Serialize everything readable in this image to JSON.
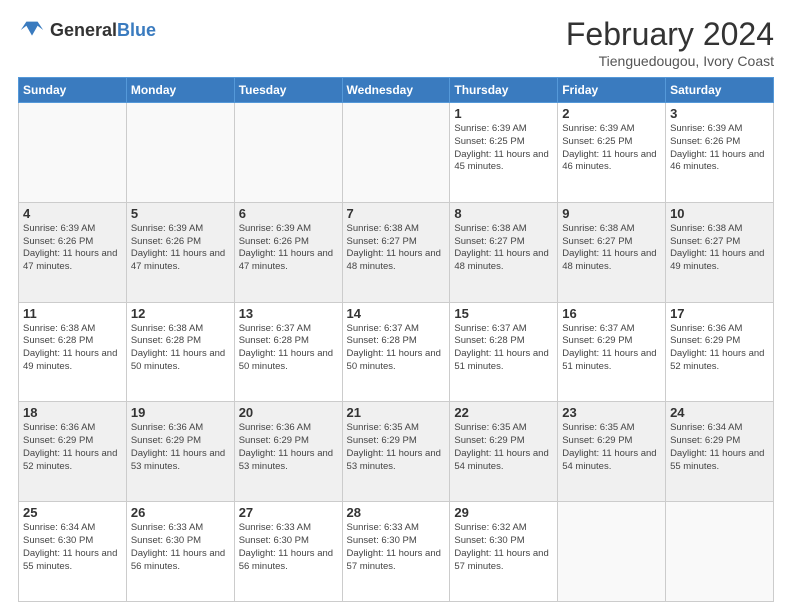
{
  "header": {
    "logo_general": "General",
    "logo_blue": "Blue",
    "month_year": "February 2024",
    "location": "Tienguedougou, Ivory Coast"
  },
  "days_of_week": [
    "Sunday",
    "Monday",
    "Tuesday",
    "Wednesday",
    "Thursday",
    "Friday",
    "Saturday"
  ],
  "weeks": [
    [
      {
        "day": "",
        "info": ""
      },
      {
        "day": "",
        "info": ""
      },
      {
        "day": "",
        "info": ""
      },
      {
        "day": "",
        "info": ""
      },
      {
        "day": "1",
        "info": "Sunrise: 6:39 AM\nSunset: 6:25 PM\nDaylight: 11 hours\nand 45 minutes."
      },
      {
        "day": "2",
        "info": "Sunrise: 6:39 AM\nSunset: 6:25 PM\nDaylight: 11 hours\nand 46 minutes."
      },
      {
        "day": "3",
        "info": "Sunrise: 6:39 AM\nSunset: 6:26 PM\nDaylight: 11 hours\nand 46 minutes."
      }
    ],
    [
      {
        "day": "4",
        "info": "Sunrise: 6:39 AM\nSunset: 6:26 PM\nDaylight: 11 hours\nand 47 minutes."
      },
      {
        "day": "5",
        "info": "Sunrise: 6:39 AM\nSunset: 6:26 PM\nDaylight: 11 hours\nand 47 minutes."
      },
      {
        "day": "6",
        "info": "Sunrise: 6:39 AM\nSunset: 6:26 PM\nDaylight: 11 hours\nand 47 minutes."
      },
      {
        "day": "7",
        "info": "Sunrise: 6:38 AM\nSunset: 6:27 PM\nDaylight: 11 hours\nand 48 minutes."
      },
      {
        "day": "8",
        "info": "Sunrise: 6:38 AM\nSunset: 6:27 PM\nDaylight: 11 hours\nand 48 minutes."
      },
      {
        "day": "9",
        "info": "Sunrise: 6:38 AM\nSunset: 6:27 PM\nDaylight: 11 hours\nand 48 minutes."
      },
      {
        "day": "10",
        "info": "Sunrise: 6:38 AM\nSunset: 6:27 PM\nDaylight: 11 hours\nand 49 minutes."
      }
    ],
    [
      {
        "day": "11",
        "info": "Sunrise: 6:38 AM\nSunset: 6:28 PM\nDaylight: 11 hours\nand 49 minutes."
      },
      {
        "day": "12",
        "info": "Sunrise: 6:38 AM\nSunset: 6:28 PM\nDaylight: 11 hours\nand 50 minutes."
      },
      {
        "day": "13",
        "info": "Sunrise: 6:37 AM\nSunset: 6:28 PM\nDaylight: 11 hours\nand 50 minutes."
      },
      {
        "day": "14",
        "info": "Sunrise: 6:37 AM\nSunset: 6:28 PM\nDaylight: 11 hours\nand 50 minutes."
      },
      {
        "day": "15",
        "info": "Sunrise: 6:37 AM\nSunset: 6:28 PM\nDaylight: 11 hours\nand 51 minutes."
      },
      {
        "day": "16",
        "info": "Sunrise: 6:37 AM\nSunset: 6:29 PM\nDaylight: 11 hours\nand 51 minutes."
      },
      {
        "day": "17",
        "info": "Sunrise: 6:36 AM\nSunset: 6:29 PM\nDaylight: 11 hours\nand 52 minutes."
      }
    ],
    [
      {
        "day": "18",
        "info": "Sunrise: 6:36 AM\nSunset: 6:29 PM\nDaylight: 11 hours\nand 52 minutes."
      },
      {
        "day": "19",
        "info": "Sunrise: 6:36 AM\nSunset: 6:29 PM\nDaylight: 11 hours\nand 53 minutes."
      },
      {
        "day": "20",
        "info": "Sunrise: 6:36 AM\nSunset: 6:29 PM\nDaylight: 11 hours\nand 53 minutes."
      },
      {
        "day": "21",
        "info": "Sunrise: 6:35 AM\nSunset: 6:29 PM\nDaylight: 11 hours\nand 53 minutes."
      },
      {
        "day": "22",
        "info": "Sunrise: 6:35 AM\nSunset: 6:29 PM\nDaylight: 11 hours\nand 54 minutes."
      },
      {
        "day": "23",
        "info": "Sunrise: 6:35 AM\nSunset: 6:29 PM\nDaylight: 11 hours\nand 54 minutes."
      },
      {
        "day": "24",
        "info": "Sunrise: 6:34 AM\nSunset: 6:29 PM\nDaylight: 11 hours\nand 55 minutes."
      }
    ],
    [
      {
        "day": "25",
        "info": "Sunrise: 6:34 AM\nSunset: 6:30 PM\nDaylight: 11 hours\nand 55 minutes."
      },
      {
        "day": "26",
        "info": "Sunrise: 6:33 AM\nSunset: 6:30 PM\nDaylight: 11 hours\nand 56 minutes."
      },
      {
        "day": "27",
        "info": "Sunrise: 6:33 AM\nSunset: 6:30 PM\nDaylight: 11 hours\nand 56 minutes."
      },
      {
        "day": "28",
        "info": "Sunrise: 6:33 AM\nSunset: 6:30 PM\nDaylight: 11 hours\nand 57 minutes."
      },
      {
        "day": "29",
        "info": "Sunrise: 6:32 AM\nSunset: 6:30 PM\nDaylight: 11 hours\nand 57 minutes."
      },
      {
        "day": "",
        "info": ""
      },
      {
        "day": "",
        "info": ""
      }
    ]
  ]
}
